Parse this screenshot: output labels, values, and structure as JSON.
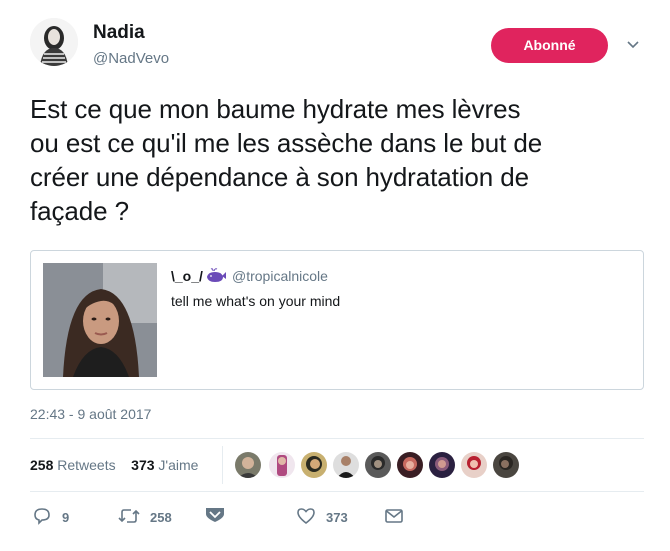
{
  "user": {
    "display_name": "Nadia",
    "handle": "@NadVevo",
    "follow_label": "Abonné"
  },
  "tweet": {
    "lines": [
      "Est ce que mon baume hydrate mes lèvres",
      "ou est ce qu'il me les assèche dans le but de",
      "créer une dépendance à son hydratation de",
      "façade ?"
    ],
    "timestamp": "22:43 - 9 août 2017"
  },
  "quoted": {
    "name": "\\_o_/",
    "name_icon": "whale-icon",
    "handle": "@tropicalnicole",
    "text": "tell me what's on your mind"
  },
  "stats": {
    "retweets_count": "258",
    "retweets_label": "Retweets",
    "likes_count": "373",
    "likes_label": "J'aime"
  },
  "actions": {
    "reply_count": "9",
    "retweet_count": "258",
    "like_count": "373"
  },
  "colors": {
    "follow_bg": "#e0245e",
    "text_primary": "#14171a",
    "text_secondary": "#657786",
    "border": "#ccd6dd",
    "icon": "#657786"
  }
}
